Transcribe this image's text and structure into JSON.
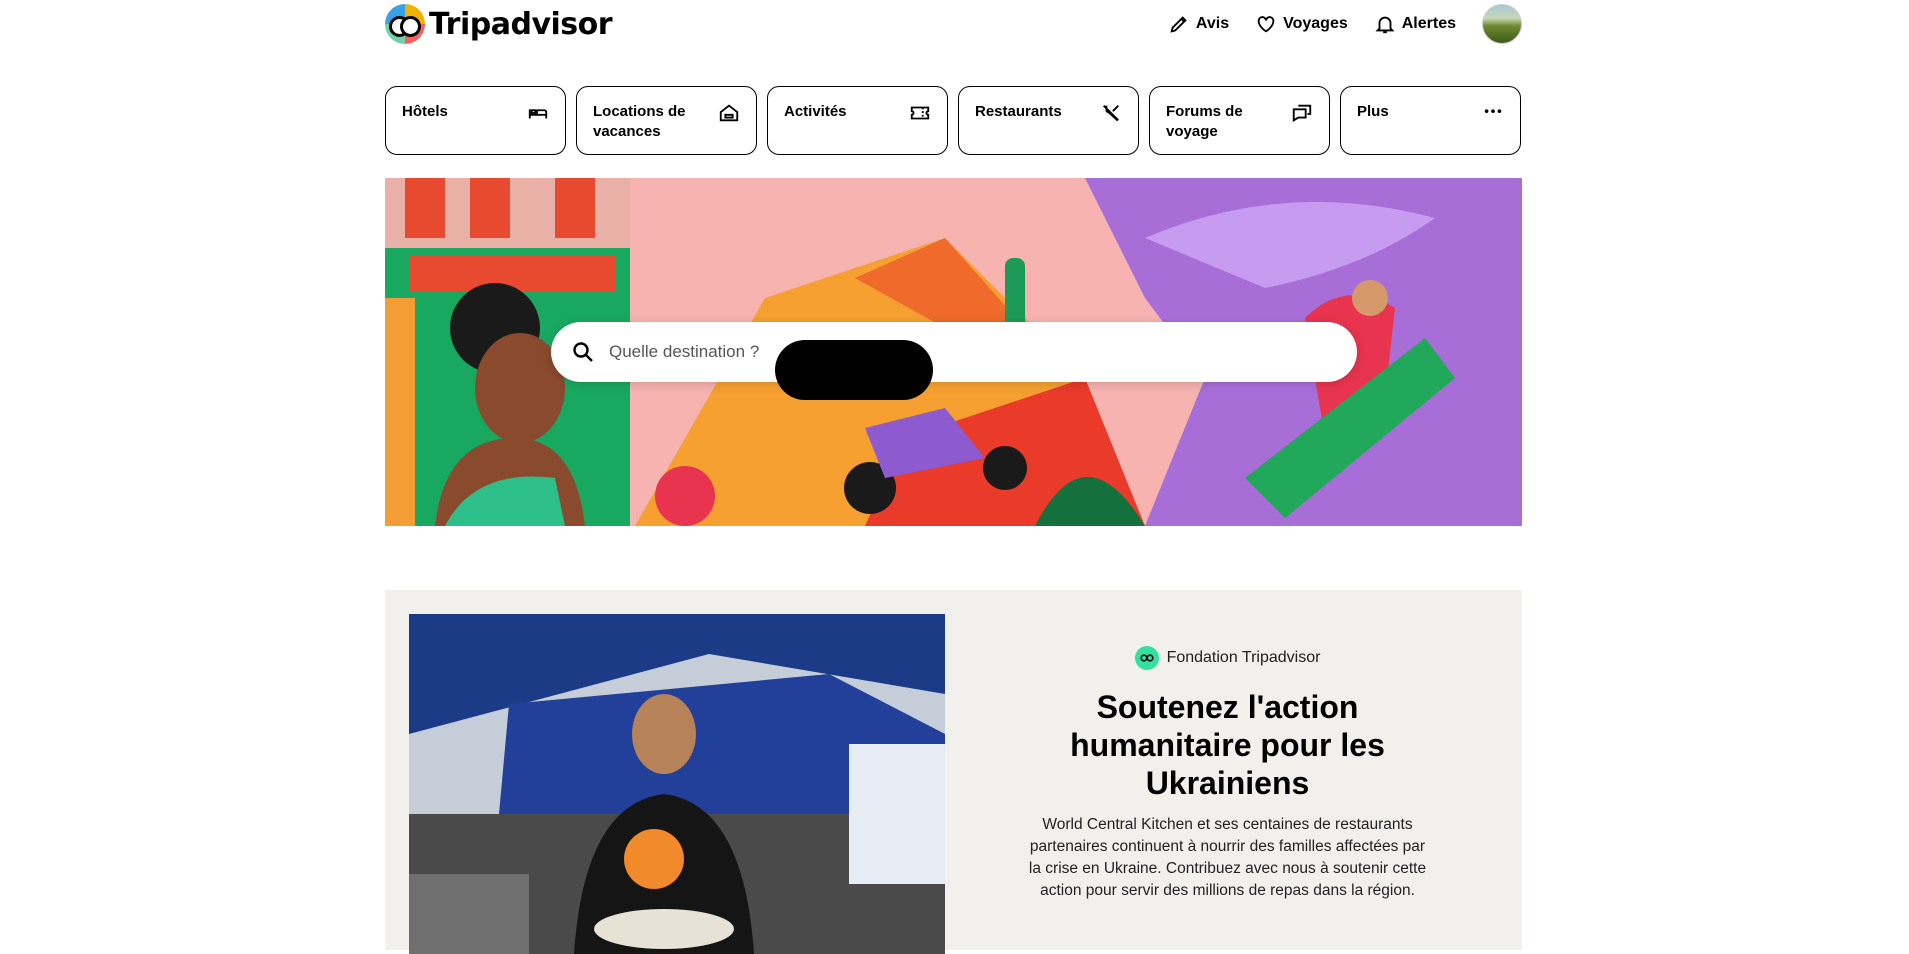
{
  "header": {
    "logo_text": "Tripadvisor",
    "nav": [
      {
        "label": "Avis",
        "icon": "pencil-icon"
      },
      {
        "label": "Voyages",
        "icon": "heart-icon"
      },
      {
        "label": "Alertes",
        "icon": "bell-icon"
      }
    ]
  },
  "tiles": [
    {
      "label": "Hôtels",
      "icon": "bed-icon"
    },
    {
      "label": "Locations de vacances",
      "icon": "house-icon"
    },
    {
      "label": "Activités",
      "icon": "ticket-icon"
    },
    {
      "label": "Restaurants",
      "icon": "utensils-icon"
    },
    {
      "label": "Forums de voyage",
      "icon": "chat-icon"
    },
    {
      "label": "Plus",
      "icon": "more-icon"
    }
  ],
  "search": {
    "placeholder": "Quelle destination ?"
  },
  "promo": {
    "badge": "Fondation Tripadvisor",
    "title": "Soutenez l'action humanitaire pour les Ukrainiens",
    "body": "World Central Kitchen et ses centaines de restaurants partenaires continuent à nourrir des familles affectées par la crise en Ukraine. Contribuez avec nous à soutenir cette action pour servir des millions de repas dans la région."
  },
  "colors": {
    "brand_green": "#34e0a1",
    "text": "#000000",
    "promo_bg": "#f2f0ec"
  }
}
